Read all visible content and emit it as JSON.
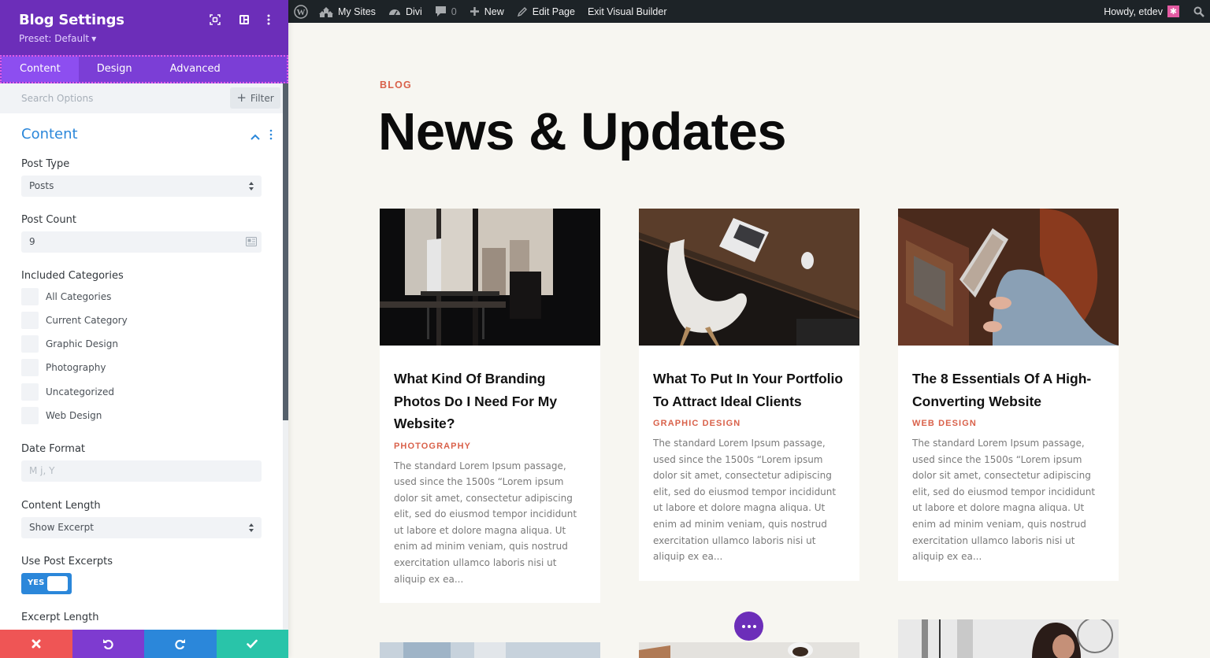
{
  "panel": {
    "title": "Blog Settings",
    "preset": "Preset: Default",
    "header_icons": [
      "focus-icon",
      "split-view-icon",
      "more-vertical-icon"
    ],
    "tabs": [
      {
        "label": "Content",
        "active": true
      },
      {
        "label": "Design",
        "active": false
      },
      {
        "label": "Advanced",
        "active": false
      }
    ],
    "search_placeholder": "Search Options",
    "filter_label": "Filter",
    "section_title": "Content",
    "fields": {
      "post_type": {
        "label": "Post Type",
        "value": "Posts"
      },
      "post_count": {
        "label": "Post Count",
        "value": "9"
      },
      "included_categories": {
        "label": "Included Categories",
        "options": [
          {
            "label": "All Categories",
            "checked": false
          },
          {
            "label": "Current Category",
            "checked": false
          },
          {
            "label": "Graphic Design",
            "checked": false
          },
          {
            "label": "Photography",
            "checked": false
          },
          {
            "label": "Uncategorized",
            "checked": false
          },
          {
            "label": "Web Design",
            "checked": false
          }
        ]
      },
      "date_format": {
        "label": "Date Format",
        "placeholder": "M j, Y"
      },
      "content_length": {
        "label": "Content Length",
        "value": "Show Excerpt"
      },
      "use_post_excerpts": {
        "label": "Use Post Excerpts",
        "value": "YES"
      },
      "excerpt_length": {
        "label": "Excerpt Length"
      }
    },
    "footer": {
      "cancel_color": "#ef5555",
      "undo_color": "#7e3bd0",
      "redo_color": "#2b87da",
      "save_color": "#29c4a9"
    }
  },
  "adminbar": {
    "items": [
      {
        "icon": "wordpress-icon",
        "label": ""
      },
      {
        "icon": "my-sites-icon",
        "label": "My Sites"
      },
      {
        "icon": "divi-dashboard-icon",
        "label": "Divi"
      },
      {
        "icon": "comment-icon",
        "label": "0"
      },
      {
        "icon": "plus-icon",
        "label": "New"
      },
      {
        "icon": "pencil-icon",
        "label": "Edit Page"
      },
      {
        "icon": "",
        "label": "Exit Visual Builder"
      }
    ],
    "howdy": "Howdy, etdev",
    "avatar_glyph": "✱"
  },
  "page": {
    "eyebrow": "BLOG",
    "headline": "News & Updates",
    "posts": [
      {
        "title": "What Kind Of Branding Photos Do I Need For My Website?",
        "category": "PHOTOGRAPHY",
        "excerpt": "The standard Lorem Ipsum passage, used since the 1500s “Lorem ipsum dolor sit amet, consectetur adipiscing elit, sed do eiusmod tempor incididunt ut labore et dolore magna aliqua. Ut enim ad minim veniam, quis nostrud exercitation ullamco laboris nisi ut aliquip ex ea...",
        "image": "office-desk-window-photo"
      },
      {
        "title": "What To Put In Your Portfolio To Attract Ideal Clients",
        "category": "GRAPHIC DESIGN",
        "excerpt": "The standard Lorem Ipsum passage, used since the 1500s “Lorem ipsum dolor sit amet, consectetur adipiscing elit, sed do eiusmod tempor incididunt ut labore et dolore magna aliqua. Ut enim ad minim veniam, quis nostrud exercitation ullamco laboris nisi ut aliquip ex ea...",
        "image": "laptop-chair-desk-photo"
      },
      {
        "title": "The 8 Essentials Of A High-Converting Website",
        "category": "WEB DESIGN",
        "excerpt": "The standard Lorem Ipsum passage, used since the 1500s “Lorem ipsum dolor sit amet, consectetur adipiscing elit, sed do eiusmod tempor incididunt ut labore et dolore magna aliqua. Ut enim ad minim veniam, quis nostrud exercitation ullamco laboris nisi ut aliquip ex ea...",
        "image": "woman-laptop-rug-photo"
      }
    ],
    "accent_color": "#d9614a",
    "builder_color": "#6c2eb9"
  }
}
